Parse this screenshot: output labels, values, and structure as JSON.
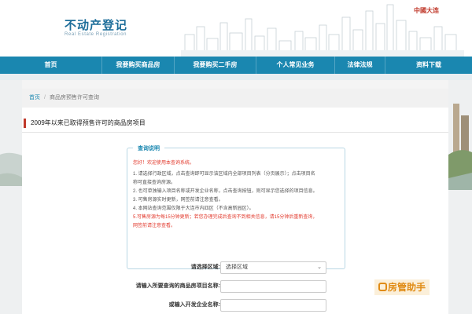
{
  "header": {
    "title": "不动产登记",
    "subtitle": "Real Estate Registration",
    "brand": "中國大连"
  },
  "nav": {
    "items": [
      {
        "label": "首页"
      },
      {
        "label": "我要购买商品房"
      },
      {
        "label": "我要购买二手房"
      },
      {
        "label": "个人常见业务"
      },
      {
        "label": "法律法规"
      },
      {
        "label": "资料下载"
      }
    ]
  },
  "breadcrumb": {
    "home": "首页",
    "separator": "/",
    "current": "商品房预售许可查询"
  },
  "section": {
    "title": "2009年以来已取得预售许可的商品房项目"
  },
  "info": {
    "heading": "查询说明",
    "greeting": "您好！欢迎使用本查询系统。",
    "line1a": "1. 请选择行政区域，点击查询即可显示该区域内全部项目列表（分页展示）；点击项目名",
    "line1b": "称可直接查询房源。",
    "line2": "2. 也可单独输入项目名称或开发企业名称，点击查询按钮，则可显示您选择的项目信息。",
    "line3": "3. 可售房源实时更新，网签前请注意查看。",
    "line4": "4. 本网站查询范围仅限于大连市内四区（不含高新园区）。",
    "line5a": "5.可售房源为每15分钟更新；若您办理完成后查询不到相关信息，请15分钟后重新查询，",
    "line5b": "网签前请注意查看。"
  },
  "form": {
    "district_label": "请选择区域:",
    "district_value": "选择区域",
    "project_label": "请输入所要查询的商品房项目名称:",
    "project_value": "",
    "developer_label": "或输入开发企业名称:",
    "developer_value": ""
  },
  "watermark": {
    "text": "房管助手"
  },
  "colors": {
    "nav": "#1a87b0",
    "accent_red": "#c0392b",
    "notice_red": "#e23b2e",
    "title_blue": "#1e6e9a"
  }
}
